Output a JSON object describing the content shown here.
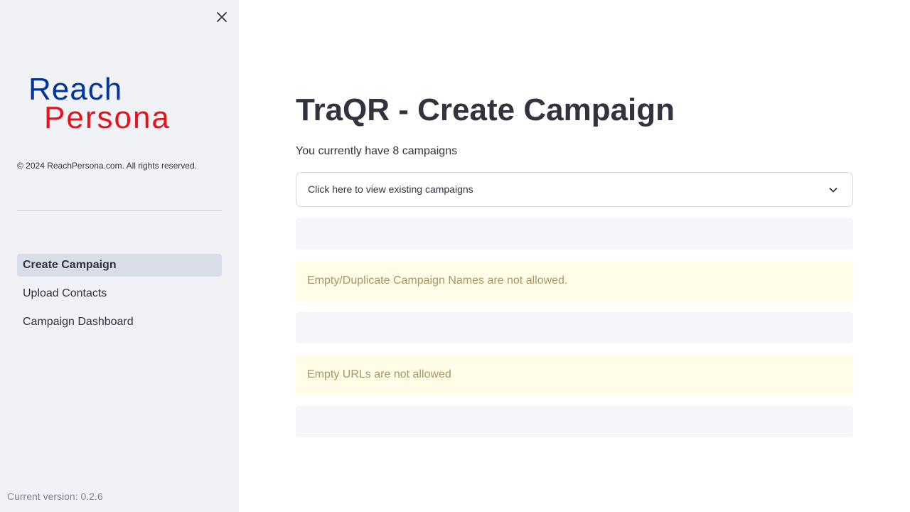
{
  "sidebar": {
    "logo": {
      "line1": "Reach",
      "line2": "Persona",
      "line1_color": "#0033a0",
      "line2_color": "#e8101a"
    },
    "copyright": "© 2024 ReachPersona.com. All rights reserved.",
    "nav": [
      {
        "label": "Create Campaign",
        "active": true
      },
      {
        "label": "Upload Contacts",
        "active": false
      },
      {
        "label": "Campaign Dashboard",
        "active": false
      }
    ],
    "version": "Current version: 0.2.6",
    "close_icon": "close-icon"
  },
  "main": {
    "title": "TraQR - Create Campaign",
    "campaign_count_text": "You currently have 8 campaigns",
    "expander": {
      "label": "Click here to view existing campaigns",
      "icon": "chevron-down-icon"
    },
    "warnings": [
      "Empty/Duplicate Campaign Names are not allowed.",
      "Empty URLs are not allowed"
    ]
  },
  "colors": {
    "sidebar_bg": "#f0f2f6",
    "nav_active_bg": "#d8dde7",
    "warning_bg": "#fffce7",
    "warning_text": "#a7966a",
    "text": "#31333f"
  }
}
